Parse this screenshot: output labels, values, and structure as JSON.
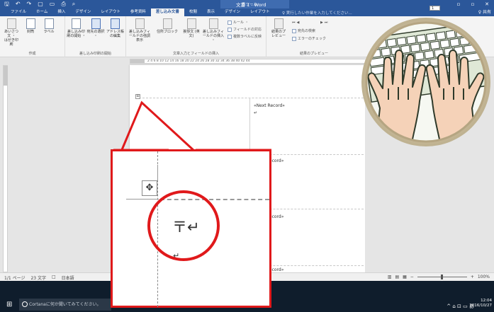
{
  "titlebar": {
    "doc_title": "文書 1 - Word",
    "context_group": "表ツール",
    "qat_icons": [
      "save-icon",
      "undo-icon",
      "redo-icon",
      "new-doc-icon",
      "open-icon",
      "quick-print-icon",
      "print-preview-icon"
    ],
    "controls": {
      "restore": "▫",
      "maximize": "▫",
      "close": "✕"
    }
  },
  "tabs": {
    "file": "ファイル",
    "home": "ホーム",
    "insert": "挿入",
    "design": "デザイン",
    "layout": "レイアウト",
    "references": "参考資料",
    "mailings": "差し込み文書",
    "review": "校閲",
    "view": "表示",
    "table_design": "デザイン",
    "table_layout": "レイアウト",
    "tell_me": "♀ 実行したい作業を入力してください...",
    "share": "♀ 共有"
  },
  "ribbon": {
    "create_group": "作成",
    "envelopes": "あいさつ文 ・",
    "envelopes_sub": "はがき印刷",
    "envelope": "封筒",
    "labels": "ラベル",
    "start_merge_group": "差し込み印刷の開始",
    "start_merge": "差し込み印刷の開始 ・",
    "select_recipients": "宛先の選択 ・",
    "edit_recipients": "アドレス帳の編集",
    "write_insert_group": "文章入力とフィールドの挿入",
    "highlight_fields": "差し込みフィールドの強調表示",
    "address_block": "住所ブロック",
    "greeting_line": "挨拶文 (英文)",
    "insert_merge_field": "差し込みフィールドの挿入 ・",
    "rules": "ルール ・",
    "match_fields": "フィールドの対応",
    "update_labels": "複数ラベルに反映",
    "preview_group": "結果のプレビュー",
    "preview_results": "結果のプレビュー",
    "record_number": "1",
    "find_recipient": "宛先の検索",
    "check_errors": "エラーのチェック"
  },
  "ruler": {
    "ticks": "2  4  6  8  10  12  14  16  18  20  22  24  26  28  30  32  34  36  38  40  42  44"
  },
  "document": {
    "next_record_1": "«Next Record»",
    "next_record_2": "Record»",
    "next_record_3": "Record»",
    "next_record_4": "Record»",
    "cell_mark": "↵",
    "table_anchor": "⊞"
  },
  "statusbar": {
    "page": "1/1 ページ",
    "words": "23 文字",
    "lang_icon": "□",
    "language": "日本語",
    "zoom": "100%"
  },
  "taskbar": {
    "search_placeholder": "Cortanaに何か聞いてみてください。",
    "time": "12:04",
    "date": "2016/10/27"
  },
  "callout": {
    "anchor_glyph": "✥",
    "mark_big": "〒↵",
    "mark_small": "↵"
  },
  "colors": {
    "word_blue": "#2b579a",
    "callout_red": "#e0191b",
    "taskbar": "#0f1d2c"
  }
}
